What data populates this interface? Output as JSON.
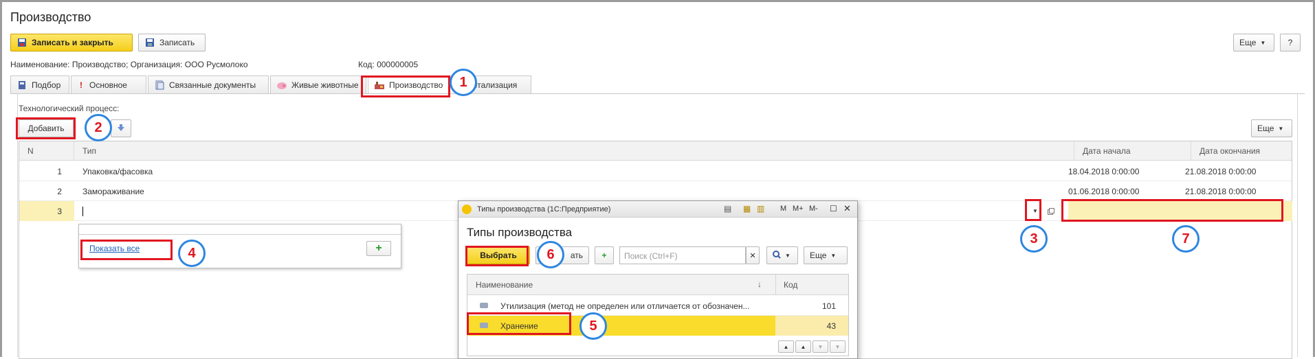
{
  "window": {
    "title": "Производство"
  },
  "toolbar": {
    "save_close": "Записать и закрыть",
    "save": "Записать",
    "more": "Еще",
    "help": "?"
  },
  "info": {
    "name_org": "Наименование: Производство; Организация: ООО Русмолоко",
    "code": "Код: 000000005"
  },
  "tabs": [
    {
      "label": "Подбор"
    },
    {
      "label": "Основное"
    },
    {
      "label": "Связанные документы"
    },
    {
      "label": "Живые животные"
    },
    {
      "label": "Производство"
    },
    {
      "label": "етализация"
    }
  ],
  "process": {
    "label": "Технологический процесс:",
    "add": "Добавить",
    "more": "Еще",
    "columns": {
      "n": "N",
      "type": "Тип",
      "start": "Дата начала",
      "end": "Дата окончания"
    },
    "rows": [
      {
        "n": "1",
        "type": "Упаковка/фасовка",
        "start": "18.04.2018 0:00:00",
        "end": "21.08.2018 0:00:00"
      },
      {
        "n": "2",
        "type": "Замораживание",
        "start": "01.06.2018 0:00:00",
        "end": "21.08.2018 0:00:00"
      },
      {
        "n": "3",
        "type": "",
        "start": "",
        "end": ""
      }
    ]
  },
  "dropdown": {
    "show_all": "Показать все",
    "add_glyph": "+"
  },
  "modal": {
    "window_title": "Типы производства  (1С:Предприятие)",
    "heading": "Типы производства",
    "select": "Выбрать",
    "create_partial": "ать",
    "search_placeholder": "Поиск (Ctrl+F)",
    "more": "Еще",
    "bar_m": "M",
    "bar_mplus": "M+",
    "bar_mminus": "M-",
    "columns": {
      "name": "Наименование",
      "sort": "↓",
      "code": "Код"
    },
    "rows": [
      {
        "name": "Утилизация (метод не определен или отличается от обозначен...",
        "code": "101"
      },
      {
        "name": "Хранение",
        "code": "43"
      }
    ]
  },
  "markers": [
    "1",
    "2",
    "3",
    "4",
    "5",
    "6",
    "7"
  ],
  "colors": {
    "accent_yellow": "#f5cf1c",
    "highlight_red": "#e0161f",
    "marker_blue": "#2e86e0",
    "selected_row": "#fbf1b6"
  }
}
